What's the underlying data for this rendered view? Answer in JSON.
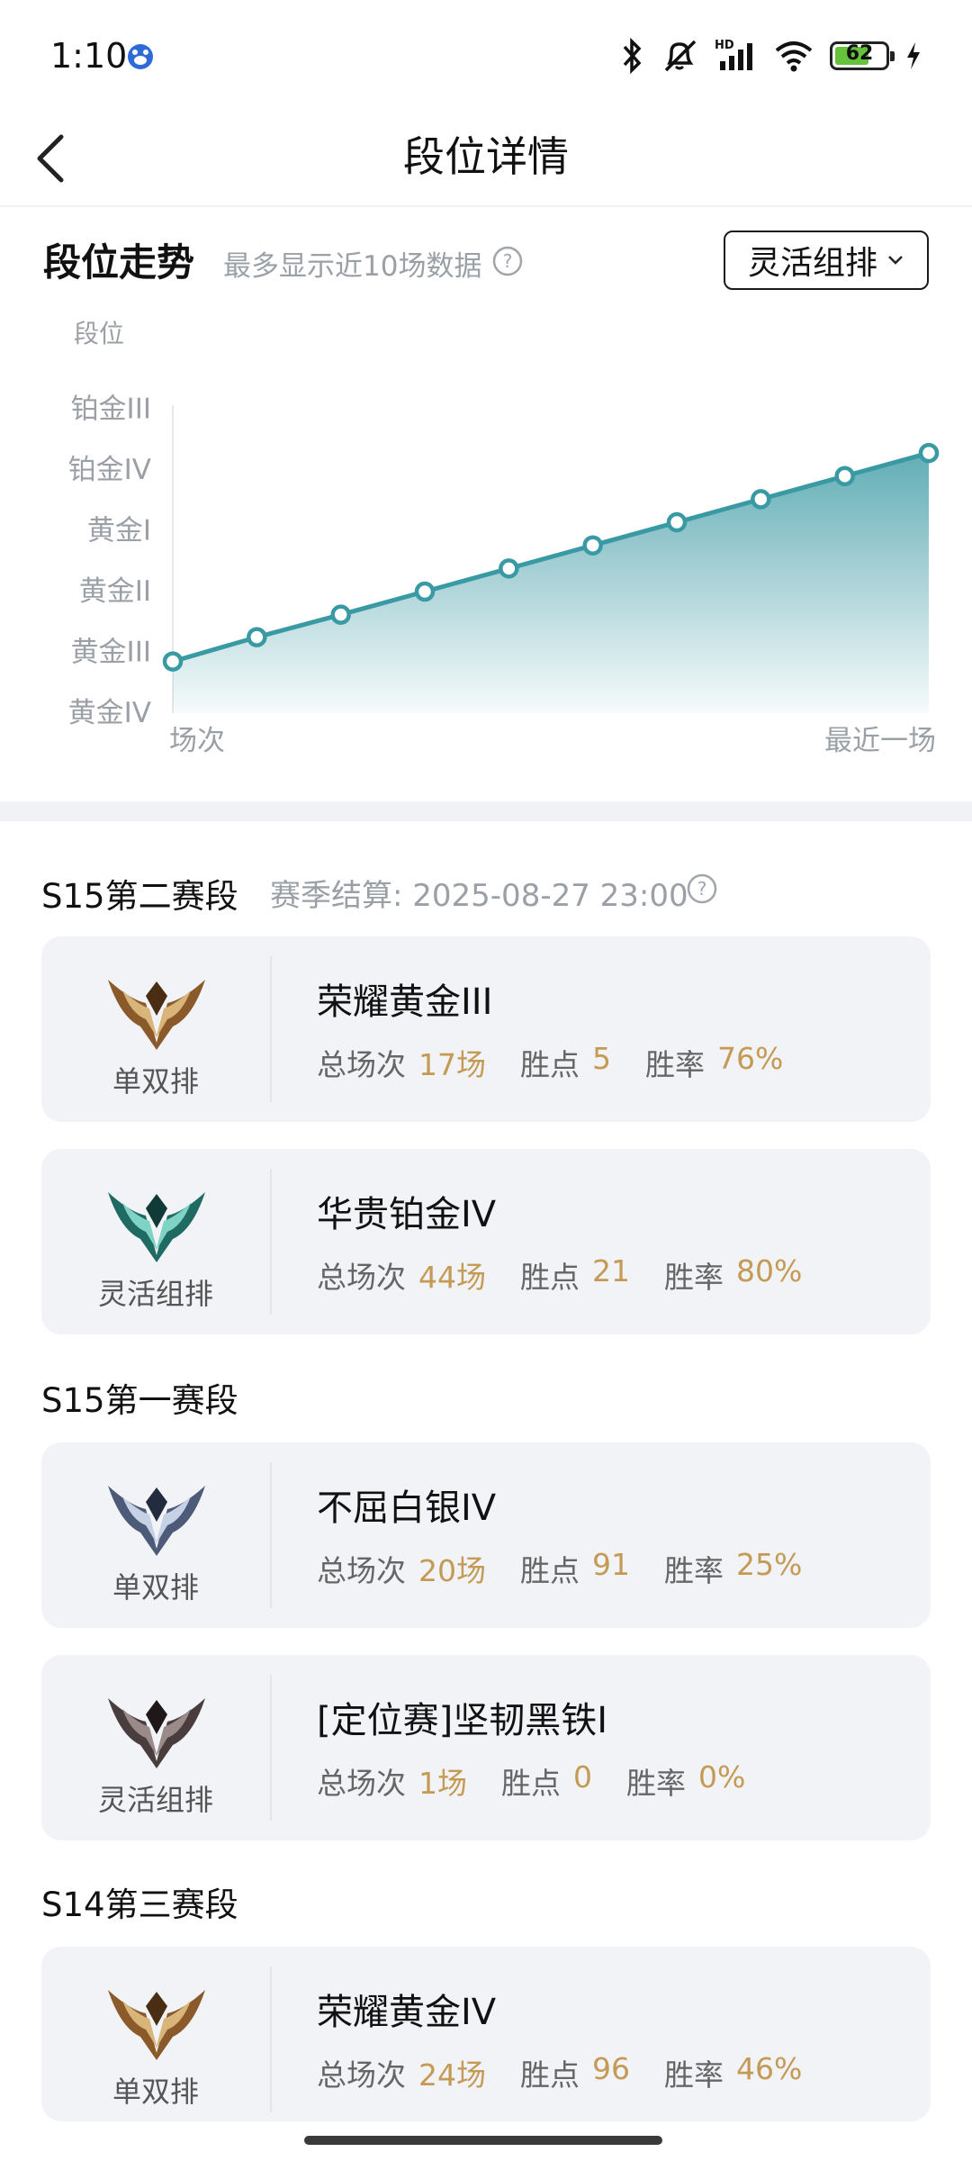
{
  "status_bar": {
    "time": "1:10",
    "battery": "62",
    "network": "HD"
  },
  "header": {
    "title": "段位详情"
  },
  "trend": {
    "title": "段位走势",
    "subtitle": "最多显示近10场数据",
    "dropdown_label": "灵活组排",
    "accent_color": "#3a9aa3"
  },
  "chart_data": {
    "type": "area",
    "ylabel": "段位",
    "y_ticks": [
      "黄金IV",
      "黄金III",
      "黄金II",
      "黄金I",
      "铂金IV",
      "铂金III"
    ],
    "x_start_label": "场次",
    "x_end_label": "最近一场",
    "points": [
      0.85,
      1.25,
      1.62,
      2.0,
      2.38,
      2.76,
      3.14,
      3.52,
      3.9,
      4.28
    ]
  },
  "seasons": [
    {
      "title": "S15第二赛段",
      "settlement": "赛季结算: 2025-08-27 23:00",
      "cards": [
        {
          "mode": "单双排",
          "rank": "荣耀黄金III",
          "emblem": "gold",
          "stats": [
            {
              "label": "总场次",
              "value": "17场"
            },
            {
              "label": "胜点",
              "value": "5"
            },
            {
              "label": "胜率",
              "value": "76%"
            }
          ]
        },
        {
          "mode": "灵活组排",
          "rank": "华贵铂金IV",
          "emblem": "platinum",
          "stats": [
            {
              "label": "总场次",
              "value": "44场"
            },
            {
              "label": "胜点",
              "value": "21"
            },
            {
              "label": "胜率",
              "value": "80%"
            }
          ]
        }
      ]
    },
    {
      "title": "S15第一赛段",
      "cards": [
        {
          "mode": "单双排",
          "rank": "不屈白银IV",
          "emblem": "silver",
          "stats": [
            {
              "label": "总场次",
              "value": "20场"
            },
            {
              "label": "胜点",
              "value": "91"
            },
            {
              "label": "胜率",
              "value": "25%"
            }
          ]
        },
        {
          "mode": "灵活组排",
          "rank": "[定位赛]坚韧黑铁I",
          "emblem": "iron",
          "stats": [
            {
              "label": "总场次",
              "value": "1场"
            },
            {
              "label": "胜点",
              "value": "0"
            },
            {
              "label": "胜率",
              "value": "0%"
            }
          ]
        }
      ]
    },
    {
      "title": "S14第三赛段",
      "cards": [
        {
          "mode": "单双排",
          "rank": "荣耀黄金IV",
          "emblem": "gold",
          "stats": [
            {
              "label": "总场次",
              "value": "24场"
            },
            {
              "label": "胜点",
              "value": "96"
            },
            {
              "label": "胜率",
              "value": "46%"
            }
          ]
        }
      ]
    }
  ]
}
